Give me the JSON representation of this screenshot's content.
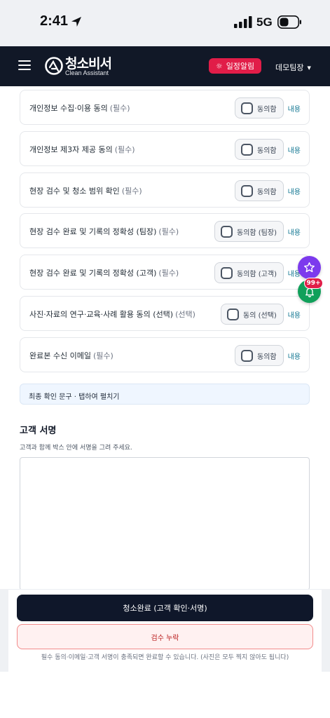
{
  "status_bar": {
    "time": "2:41",
    "network": "5G",
    "icons": [
      "location-arrow-icon",
      "signal-icon",
      "battery-icon"
    ]
  },
  "header": {
    "menu_icon": "hamburger-icon",
    "logo_title": "청소비서",
    "logo_subtitle": "Clean Assistant",
    "alarm_label": "일정알림",
    "team_label": "데모팀장",
    "alarm_color": "#e11d48",
    "header_color": "#111827"
  },
  "consents": [
    {
      "label": "개인정보 수집·이용 동의",
      "required": "(필수)",
      "agree": "동의함",
      "detail": "내용"
    },
    {
      "label": "개인정보 제3자 제공 동의",
      "required": "(필수)",
      "agree": "동의함",
      "detail": "내용"
    },
    {
      "label": "현장 검수 및 청소 범위 확인",
      "required": "(필수)",
      "agree": "동의함",
      "detail": "내용"
    },
    {
      "label": "현장 검수 완료 및 기록의 정확성 (팀장)",
      "required": "(필수)",
      "agree": "동의함 (팀장)",
      "detail": "내용"
    },
    {
      "label": "현장 검수 완료 및 기록의 정확성 (고객)",
      "required": "(필수)",
      "agree": "동의함 (고객)",
      "detail": "내용"
    },
    {
      "label": "사진·자료의 연구·교육·사례 활용 동의 (선택)",
      "required": "(선택)",
      "agree": "동의 (선택)",
      "detail": "내용"
    },
    {
      "label": "완료본 수신 이메일",
      "required": "(필수)",
      "agree": "동의함",
      "detail": "내용"
    }
  ],
  "final_toggle": "최종 확인 문구 · 탭하여 펼치기",
  "signature": {
    "title": "고객 서명",
    "description": "고객과 함께 박스 안에 서명을 그려 주세요."
  },
  "floating": {
    "star_icon": "star-icon",
    "bell_icon": "bell-icon",
    "badge": "99+"
  },
  "actions": {
    "complete_label": "청소완료 (고객 확인·서명)",
    "missing_label": "검수 누락",
    "footnote": "필수 동의·이메일·고객 서명이 충족되면 완료할 수 있습니다. (사진은 모두 찍지 않아도 됩니다)"
  }
}
